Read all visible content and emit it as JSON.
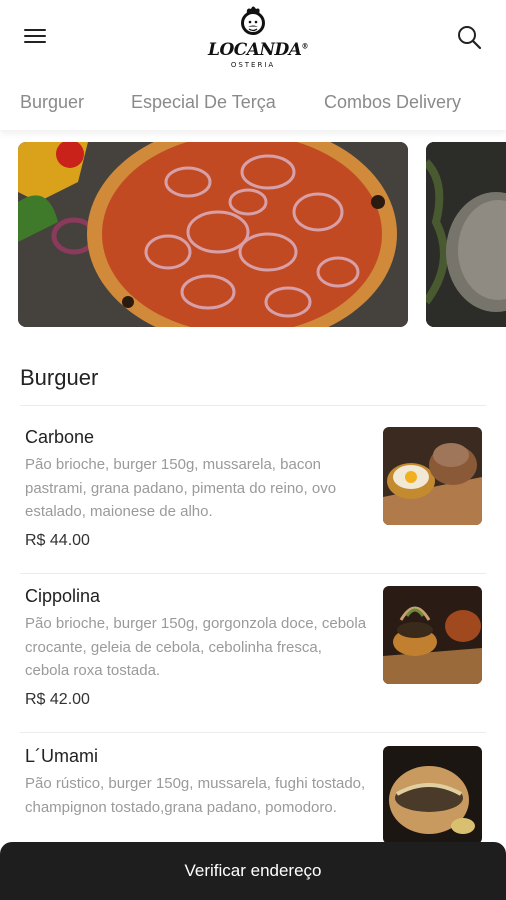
{
  "header": {
    "brand": "LOCANDA",
    "brand_reg": "®",
    "brand_sub": "OSTERIA",
    "menu_icon": "hamburger-menu-icon",
    "search_icon": "search-icon"
  },
  "tabs": [
    {
      "label": "Burguer"
    },
    {
      "label": "Especial De Terça"
    },
    {
      "label": "Combos Delivery"
    }
  ],
  "section": {
    "title": "Burguer"
  },
  "items": [
    {
      "name": "Carbone",
      "description": "Pão brioche, burger 150g, mussarela, bacon pastrami, grana padano, pimenta do reino, ovo estalado, maionese de alho.",
      "price": "R$ 44.00"
    },
    {
      "name": "Cippolina",
      "description": "Pão brioche, burger 150g, gorgonzola doce, cebola crocante, geleia de cebola, cebolinha fresca, cebola roxa tostada.",
      "price": "R$ 42.00"
    },
    {
      "name": "L´Umami",
      "description": "Pão rústico, burger 150g, mussarela, fughi tostado, champignon tostado,grana padano, pomodoro.",
      "price": ""
    }
  ],
  "cta": {
    "label": "Verificar endereço"
  },
  "colors": {
    "cta_background": "#1e1e1e",
    "tab_text": "#8a8a8a",
    "description_text": "#9a9a9a"
  }
}
